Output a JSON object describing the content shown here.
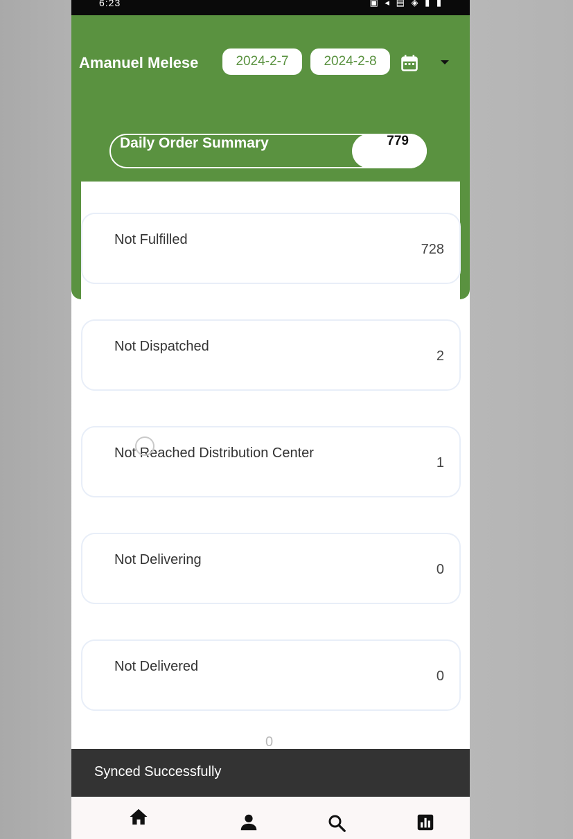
{
  "status_bar": {
    "time": "6:23",
    "icons": "▣ ◂ ▤ ◈ ▮ ▮"
  },
  "header": {
    "user_name": "Amanuel Melese",
    "date_start": "2024-2-7",
    "date_end": "2024-2-8",
    "calendar_icon": "calendar-icon",
    "dropdown_icon": "caret-down-icon"
  },
  "summary": {
    "label": "Daily Order Summary",
    "count": "779"
  },
  "cards": [
    {
      "label": "Not Fulfilled",
      "value": "728"
    },
    {
      "label": "Not Dispatched",
      "value": "2"
    },
    {
      "label": "Not Reached Distribution Center",
      "value": "1"
    },
    {
      "label": "Not Delivering",
      "value": "0"
    },
    {
      "label": "Not Delivered",
      "value": "0"
    }
  ],
  "footer_value": "0",
  "snackbar": {
    "message": "Synced Successfully"
  },
  "bottom_nav": [
    {
      "name": "home",
      "icon": "home-icon"
    },
    {
      "name": "profile",
      "icon": "person-icon"
    },
    {
      "name": "search",
      "icon": "search-icon"
    },
    {
      "name": "reports",
      "icon": "bar-chart-icon"
    }
  ],
  "colors": {
    "primary_green": "#5a9240",
    "snackbar_bg": "#333333",
    "card_border": "#e8eef8"
  }
}
